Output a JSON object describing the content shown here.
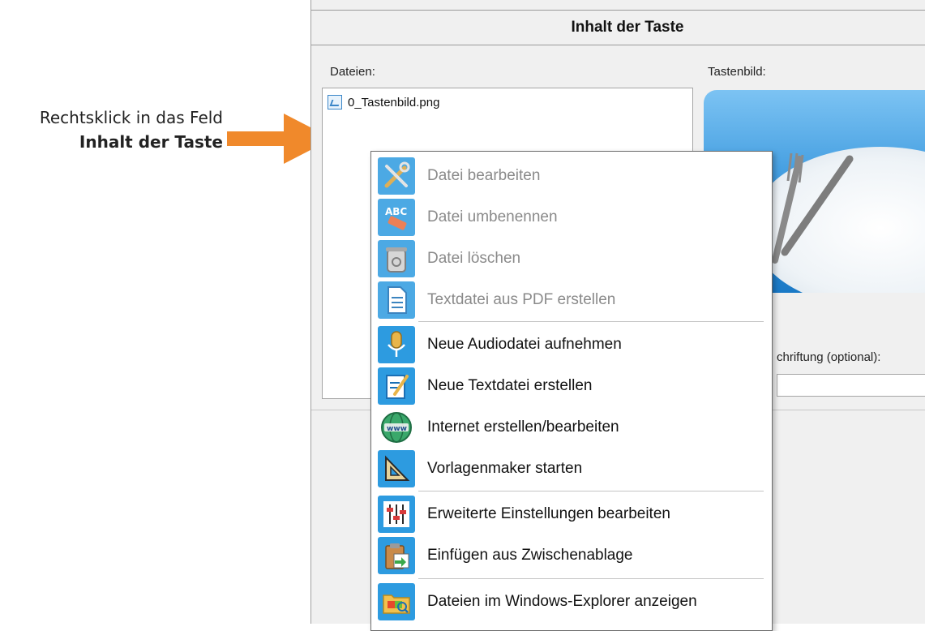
{
  "annotation": {
    "line1": "Rechtsklick in das Feld",
    "line2": "Inhalt der Taste"
  },
  "panel": {
    "title": "Inhalt der Taste",
    "files_label": "Dateien:",
    "preview_label": "Tastenbild:",
    "caption_label": "chriftung (optional):",
    "caption_value": "",
    "files": [
      {
        "name": "0_Tastenbild.png",
        "icon": "image-file-icon"
      }
    ]
  },
  "context_menu": {
    "items": [
      {
        "label": "Datei bearbeiten",
        "icon": "tools-icon",
        "enabled": false
      },
      {
        "label": "Datei umbenennen",
        "icon": "rename-abc-icon",
        "enabled": false
      },
      {
        "label": "Datei löschen",
        "icon": "trash-icon",
        "enabled": false
      },
      {
        "label": "Textdatei aus PDF erstellen",
        "icon": "document-icon",
        "enabled": false
      },
      {
        "label": "Neue Audiodatei aufnehmen",
        "icon": "microphone-icon",
        "enabled": true
      },
      {
        "label": "Neue Textdatei erstellen",
        "icon": "edit-note-icon",
        "enabled": true
      },
      {
        "label": "Internet erstellen/bearbeiten",
        "icon": "www-globe-icon",
        "enabled": true
      },
      {
        "label": "Vorlagenmaker starten",
        "icon": "template-ruler-icon",
        "enabled": true
      },
      {
        "label": "Erweiterte Einstellungen bearbeiten",
        "icon": "sliders-icon",
        "enabled": true
      },
      {
        "label": "Einfügen aus Zwischenablage",
        "icon": "clipboard-paste-icon",
        "enabled": true
      },
      {
        "label": "Dateien im Windows-Explorer anzeigen",
        "icon": "explorer-folder-icon",
        "enabled": true
      }
    ]
  },
  "colors": {
    "arrow": "#f0892b",
    "icon_bg": "#2d9be0",
    "disabled_text": "#8a8a8a"
  }
}
